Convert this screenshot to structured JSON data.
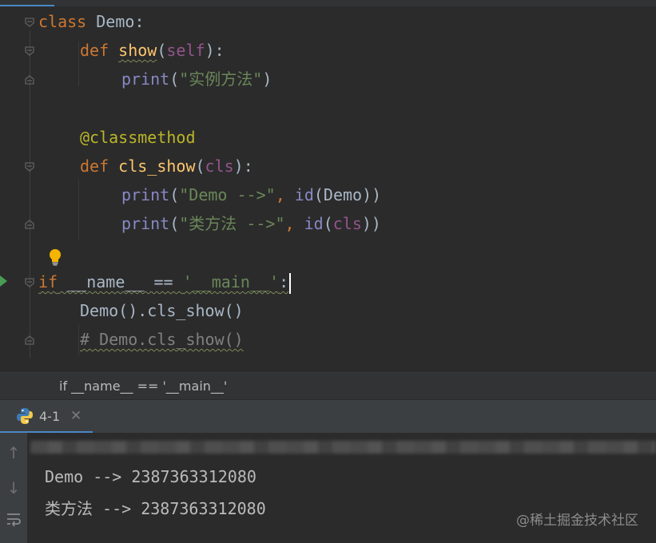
{
  "editor": {
    "lines": {
      "l1": {
        "kw": "class",
        "name": "Demo",
        "colon": ":"
      },
      "l2": {
        "kw": "def",
        "fn": "show",
        "open": "(",
        "self": "self",
        "close": "):"
      },
      "l3": {
        "builtin": "print",
        "open": "(",
        "str": "\"实例方法\"",
        "close": ")"
      },
      "l5": {
        "deco": "@classmethod"
      },
      "l6": {
        "kw": "def",
        "fn": "cls_show",
        "open": "(",
        "self": "cls",
        "close": "):"
      },
      "l7": {
        "builtin": "print",
        "open": "(",
        "str": "\"Demo -->\"",
        "sep": ", ",
        "builtin2": "id",
        "open2": "(",
        "arg": "Demo",
        "close": "))"
      },
      "l8": {
        "builtin": "print",
        "open": "(",
        "str": "\"类方法 -->\"",
        "sep": ", ",
        "builtin2": "id",
        "open2": "(",
        "arg": "cls",
        "close": "))"
      },
      "l10": {
        "kw": "if",
        "plain": " __name__ == ",
        "str": "'__main__'",
        "colon": ":"
      },
      "l11": {
        "plain": "Demo().cls_show()"
      },
      "l12": {
        "comment": "# Demo.cls_show()"
      }
    }
  },
  "breadcrumb": {
    "text": "if __name__ == '__main__'"
  },
  "run": {
    "tab_label": "4-1",
    "close_symbol": "✕",
    "output": [
      "Demo --> 2387363312080",
      "类方法 --> 2387363312080"
    ],
    "tools": {
      "up": "↑",
      "down": "↓"
    }
  },
  "watermark": "@稀土掘金技术社区",
  "colors": {
    "background": "#2b2b2b",
    "keyword": "#cc7832",
    "function": "#ffc66d",
    "string": "#6a8759",
    "builtin": "#8888c6",
    "self": "#94558d",
    "decorator": "#bbb529",
    "comment": "#808080",
    "accent": "#4a88c7"
  },
  "icons": [
    "run-arrow-icon",
    "lightbulb-icon",
    "python-icon",
    "close-icon",
    "fold-marker-icon",
    "arrow-up-icon",
    "arrow-down-icon",
    "soft-wrap-icon"
  ]
}
